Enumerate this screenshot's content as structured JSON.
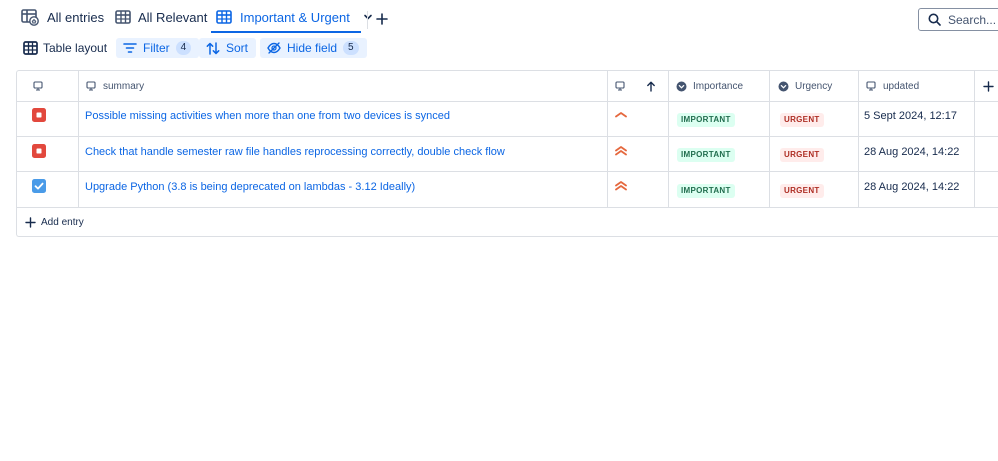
{
  "tabs": [
    {
      "label": "All entries",
      "icon": "table-home-icon",
      "active": false
    },
    {
      "label": "All Relevant",
      "icon": "table-icon",
      "active": false
    },
    {
      "label": "Important & Urgent",
      "icon": "table-icon",
      "active": true
    }
  ],
  "search": {
    "placeholder": "Search..."
  },
  "toolbar": {
    "layout_label": "Table layout",
    "filter_label": "Filter",
    "filter_count": "4",
    "sort_label": "Sort",
    "hide_label": "Hide field",
    "hide_count": "5"
  },
  "table": {
    "columns": {
      "summary": "summary",
      "importance": "Importance",
      "urgency": "Urgency",
      "updated": "updated"
    },
    "rows": [
      {
        "status": "red-stop",
        "summary": "Possible missing activities when more than one from two devices is synced",
        "priority": "high",
        "importance": "IMPORTANT",
        "urgency": "URGENT",
        "updated": "5 Sept 2024, 12:17"
      },
      {
        "status": "red-stop",
        "summary": "Check that handle semester raw file handles reprocessing correctly, double check flow",
        "priority": "highest",
        "importance": "IMPORTANT",
        "urgency": "URGENT",
        "updated": "28 Aug 2024, 14:22"
      },
      {
        "status": "blue-check",
        "summary": "Upgrade Python (3.8 is being deprecated on lambdas - 3.12 Ideally)",
        "priority": "highest",
        "importance": "IMPORTANT",
        "urgency": "URGENT",
        "updated": "28 Aug 2024, 14:22"
      }
    ],
    "add_entry_label": "Add entry"
  },
  "colors": {
    "accent": "#0c66e4",
    "important_bg": "#dcfff1",
    "important_text": "#216e4e",
    "urgent_bg": "#ffeceb",
    "urgent_text": "#ae2e24",
    "stop_red": "#e2483d",
    "check_blue": "#4a9be8",
    "priority_orange": "#e5683e"
  }
}
